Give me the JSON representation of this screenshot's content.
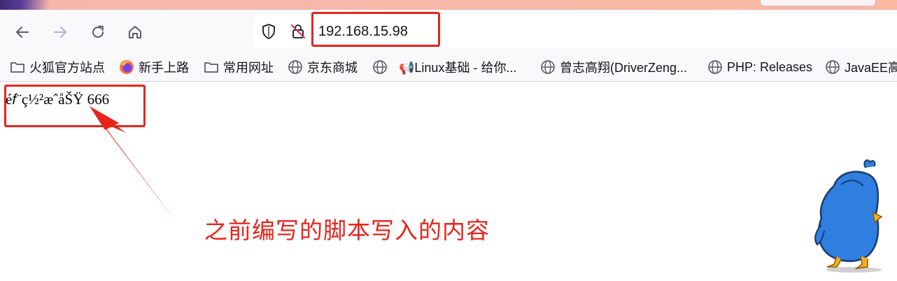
{
  "browser": {
    "url": "192.168.15.98",
    "nav": {
      "back_icon": "arrow-left-icon",
      "forward_icon": "arrow-right-icon",
      "reload_icon": "reload-icon",
      "home_icon": "home-icon"
    }
  },
  "bookmarks": [
    {
      "label": "火狐官方站点",
      "icon": "folder-icon"
    },
    {
      "label": "新手上路",
      "icon": "firefox-icon"
    },
    {
      "label": "常用网址",
      "icon": "folder-icon"
    },
    {
      "label": "京东商城",
      "icon": "globe-icon"
    },
    {
      "label": "",
      "icon": "globe-icon"
    },
    {
      "label": "📢Linux基础 - 给你...",
      "icon": "megaphone-icon"
    },
    {
      "label": "曾志高翔(DriverZeng...",
      "icon": "globe-icon"
    },
    {
      "label": "PHP: Releases",
      "icon": "globe-icon"
    },
    {
      "label": "JavaEE高",
      "icon": "globe-icon"
    }
  ],
  "page": {
    "garbled_text": "é𝑓¨ç½²æˆåŠŸ 666",
    "annotation": "之前编写的脚本写入的内容"
  },
  "colors": {
    "highlight": "#e8241c",
    "mascot_blue": "#2f7fe0",
    "mascot_beak": "#f0b020"
  }
}
